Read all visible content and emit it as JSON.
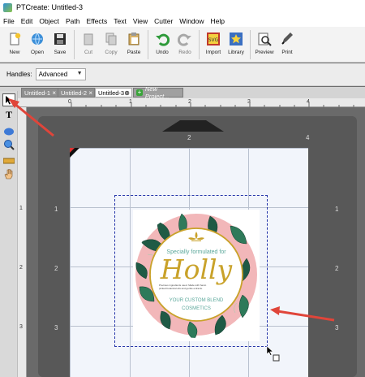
{
  "window": {
    "title": "PTCreate: Untitled-3"
  },
  "menu": [
    "File",
    "Edit",
    "Object",
    "Path",
    "Effects",
    "Text",
    "View",
    "Cutter",
    "Window",
    "Help"
  ],
  "toolbar": {
    "new": "New",
    "open": "Open",
    "save": "Save",
    "cut": "Cut",
    "copy": "Copy",
    "paste": "Paste",
    "undo": "Undo",
    "redo": "Redo",
    "import": "Import",
    "library": "Library",
    "preview": "Preview",
    "print": "Print"
  },
  "handles": {
    "label": "Handles:",
    "value": "Advanced"
  },
  "tabs": [
    "Untitled-1",
    "Untitled-2",
    "Untitled-3"
  ],
  "new_project_tab": "New Project...",
  "ruler": {
    "h": [
      "0",
      "1",
      "2",
      "3",
      "4"
    ],
    "v": [
      "1",
      "2",
      "3"
    ]
  },
  "sticker": {
    "line1": "Specially formulated for",
    "name": "Holly",
    "fine_print": "Precious ingredients used. Made with hand-picked botanical oils and gentle extracts.",
    "line3": "YOUR CUSTOM BLEND",
    "line4": "COSMETICS"
  },
  "colors": {
    "accent_arrow": "#e0453a",
    "selection": "#2333a8",
    "gold": "#c9a22a",
    "teal": "#5aa79a"
  }
}
